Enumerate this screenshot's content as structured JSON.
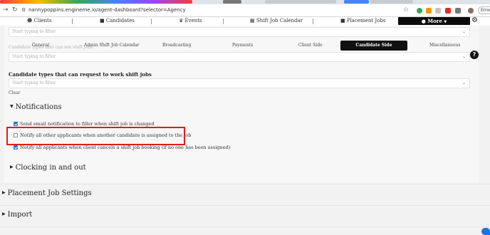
{
  "browser": {
    "url": "nannypoppins.engineme.io/agent-dashboard?selector=Agency",
    "error_button": "Error"
  },
  "app_nav": {
    "items": [
      {
        "label": "Clients",
        "icon": "user-circle-icon"
      },
      {
        "label": "Candidates",
        "icon": "briefcase-icon"
      },
      {
        "label": "Events",
        "icon": "trophy-icon"
      },
      {
        "label": "Shift Job Calendar",
        "icon": "calendar-icon"
      },
      {
        "label": "Placement Jobs",
        "icon": "briefcase-icon"
      }
    ],
    "more_label": "More",
    "settings_icon": "gear-icon"
  },
  "filters": {
    "placeholder": "Start typing to filter"
  },
  "ghost_labels": {
    "top": "Candidate types that can see shift jobs",
    "mid": "Candidate types that can see shift jobs"
  },
  "sub_tabs": {
    "items": [
      "General",
      "Admin Shift Job Calendar",
      "Broadcasting",
      "Payments",
      "Client Side",
      "Candidate Side",
      "Miscellaneous"
    ],
    "active": "Candidate Side"
  },
  "request_section": {
    "label": "Candidate types that can request to work shift jobs",
    "clear": "Clear"
  },
  "notifications": {
    "title": "Notifications",
    "options": [
      {
        "label": "Send email notification to filler when shift job is changed",
        "checked": true
      },
      {
        "label": "Notify all other applicants when another candidate is assigned to the job",
        "checked": false
      },
      {
        "label": "Notify all applicants when client cancels a shift job booking (if no one has been assigned)",
        "checked": true
      }
    ]
  },
  "sections": {
    "clocking": "Clocking in and out",
    "placement": "Placement Job Settings",
    "import": "Import"
  },
  "colors": {
    "accent": "#1a73e8",
    "highlight": "#e01b1b",
    "dark": "#111111"
  }
}
